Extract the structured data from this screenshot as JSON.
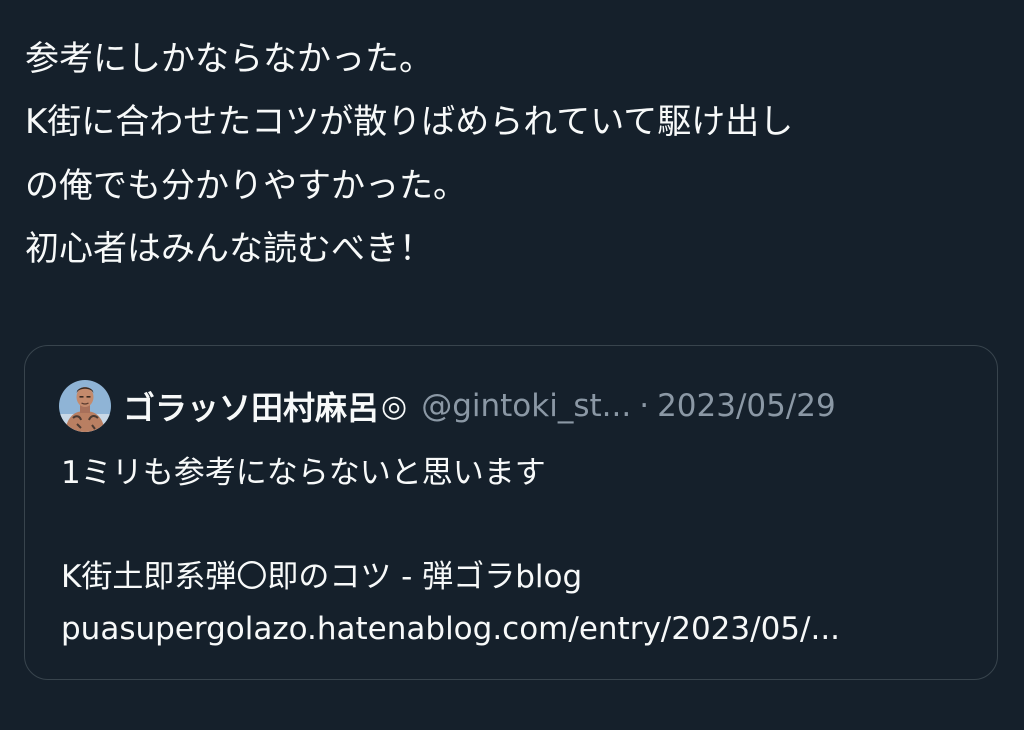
{
  "tweet": {
    "lines": [
      "参考にしかならなかった。",
      "K街に合わせたコツが散りばめられていて駆け出し",
      "の俺でも分かりやすかった。",
      "初心者はみんな読むべき！"
    ]
  },
  "quoted_tweet": {
    "author": {
      "display_name": "ゴラッソ田村麻呂",
      "name_symbol": "◎",
      "handle": "@gintoki_st...",
      "avatar": "user-avatar"
    },
    "separator": "·",
    "date": "2023/05/29",
    "text": "1ミリも参考にならないと思います",
    "link_title": "K街土即系弾〇即のコツ - 弾ゴラblog",
    "link_url": "puasupergolazo.hatenablog.com/entry/2023/05/..."
  },
  "colors": {
    "background": "#15202b",
    "text_primary": "#f7f9f9",
    "text_secondary": "#8b98a5",
    "border": "#38444d"
  }
}
